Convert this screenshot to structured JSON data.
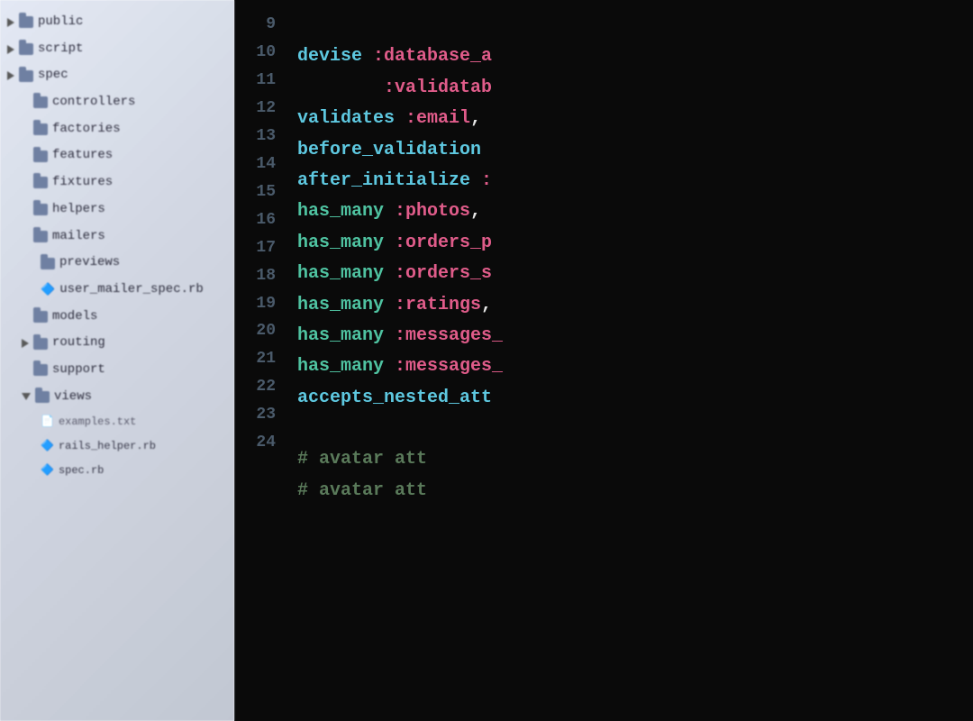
{
  "filetree": {
    "items": [
      {
        "id": "public",
        "label": "public",
        "indent": "indent1",
        "type": "folder",
        "triangle": "right"
      },
      {
        "id": "script",
        "label": "script",
        "indent": "indent1",
        "type": "folder",
        "triangle": "right"
      },
      {
        "id": "spec",
        "label": "spec",
        "indent": "indent1",
        "type": "folder",
        "triangle": "right"
      },
      {
        "id": "controllers",
        "label": "controllers",
        "indent": "indent2",
        "type": "folder",
        "triangle": "none"
      },
      {
        "id": "factories",
        "label": "factories",
        "indent": "indent2",
        "type": "folder",
        "triangle": "none"
      },
      {
        "id": "features",
        "label": "features",
        "indent": "indent2",
        "type": "folder",
        "triangle": "none"
      },
      {
        "id": "fixtures",
        "label": "fixtures",
        "indent": "indent2",
        "type": "folder",
        "triangle": "none"
      },
      {
        "id": "helpers",
        "label": "helpers",
        "indent": "indent2",
        "type": "folder",
        "triangle": "none"
      },
      {
        "id": "mailers",
        "label": "mailers",
        "indent": "indent2",
        "type": "folder",
        "triangle": "down"
      },
      {
        "id": "previews",
        "label": "previews",
        "indent": "indent3",
        "type": "folder",
        "triangle": "none"
      },
      {
        "id": "user_mailer_spec",
        "label": "user_mailer_spec.rb",
        "indent": "indent3",
        "type": "ruby",
        "triangle": "none"
      },
      {
        "id": "models",
        "label": "models",
        "indent": "indent2",
        "type": "folder",
        "triangle": "none"
      },
      {
        "id": "routing",
        "label": "routing",
        "indent": "indent2",
        "type": "folder",
        "triangle": "right"
      },
      {
        "id": "support",
        "label": "support",
        "indent": "indent2",
        "type": "folder",
        "triangle": "none"
      },
      {
        "id": "views",
        "label": "views",
        "indent": "indent2",
        "type": "folder",
        "triangle": "down"
      },
      {
        "id": "examples_txt",
        "label": "examples.txt",
        "indent": "indent3",
        "type": "file",
        "triangle": "none"
      },
      {
        "id": "rails_helper",
        "label": "rails_helper.rb",
        "indent": "indent3",
        "type": "ruby",
        "triangle": "none"
      },
      {
        "id": "spec_rb",
        "label": "spec.rb",
        "indent": "indent3",
        "type": "ruby",
        "triangle": "none"
      }
    ]
  },
  "editor": {
    "lines": [
      {
        "num": "9",
        "code": ""
      },
      {
        "num": "10",
        "code": "devise :database_a"
      },
      {
        "num": "11",
        "code": "        :validatab"
      },
      {
        "num": "12",
        "code": "validates :email,"
      },
      {
        "num": "13",
        "code": "before_validation"
      },
      {
        "num": "14",
        "code": "after_initialize :"
      },
      {
        "num": "15",
        "code": "has_many :photos,"
      },
      {
        "num": "16",
        "code": "has_many :orders_p"
      },
      {
        "num": "17",
        "code": "has_many :orders_s"
      },
      {
        "num": "18",
        "code": "has_many :ratings,"
      },
      {
        "num": "19",
        "code": "has_many :messages_"
      },
      {
        "num": "20",
        "code": "has_many :messages_"
      },
      {
        "num": "21",
        "code": "accepts_nested_att"
      },
      {
        "num": "22",
        "code": ""
      },
      {
        "num": "23",
        "code": "# avatar att"
      },
      {
        "num": "24",
        "code": "# avatar att"
      }
    ]
  }
}
